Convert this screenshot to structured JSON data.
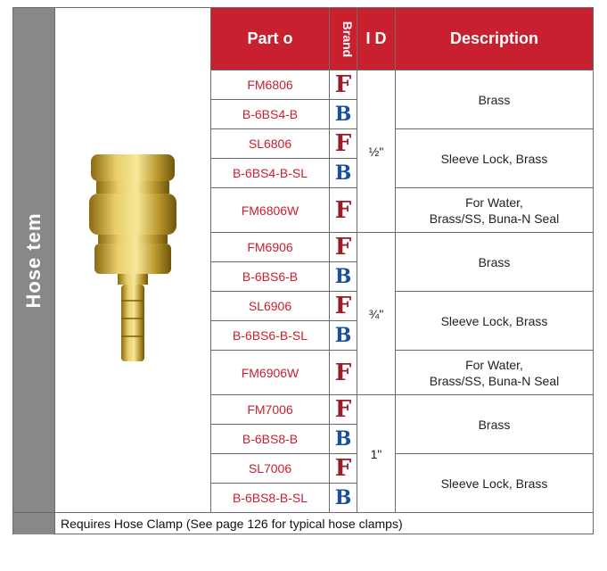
{
  "side_label": "Hose  tem",
  "header": {
    "part_no": "Part  o",
    "brand": "Brand",
    "id": "I D",
    "description": "Description"
  },
  "id_groups": [
    {
      "label": "½\""
    },
    {
      "label": "¾\""
    },
    {
      "label": "1\""
    }
  ],
  "rows": [
    {
      "part": "FM6806",
      "brand": "F"
    },
    {
      "part": "B-6BS4-B",
      "brand": "B"
    },
    {
      "part": "SL6806",
      "brand": "F"
    },
    {
      "part": "B-6BS4-B-SL",
      "brand": "B"
    },
    {
      "part": "FM6806W",
      "brand": "F"
    },
    {
      "part": "FM6906",
      "brand": "F"
    },
    {
      "part": "B-6BS6-B",
      "brand": "B"
    },
    {
      "part": "SL6906",
      "brand": "F"
    },
    {
      "part": "B-6BS6-B-SL",
      "brand": "B"
    },
    {
      "part": "FM6906W",
      "brand": "F"
    },
    {
      "part": "FM7006",
      "brand": "F"
    },
    {
      "part": "B-6BS8-B",
      "brand": "B"
    },
    {
      "part": "SL7006",
      "brand": "F"
    },
    {
      "part": "B-6BS8-B-SL",
      "brand": "B"
    }
  ],
  "descriptions": [
    {
      "line1": "Brass",
      "line2": ""
    },
    {
      "line1": "Sleeve Lock, Brass",
      "line2": ""
    },
    {
      "line1": "For Water,",
      "line2": "Brass/SS, Buna-N Seal"
    },
    {
      "line1": "Brass",
      "line2": ""
    },
    {
      "line1": "Sleeve Lock, Brass",
      "line2": ""
    },
    {
      "line1": "For Water,",
      "line2": "Brass/SS, Buna-N Seal"
    },
    {
      "line1": "Brass",
      "line2": ""
    },
    {
      "line1": "Sleeve Lock, Brass",
      "line2": ""
    }
  ],
  "footer_note": "Requires Hose Clamp (See page 126 for typical hose clamps)",
  "colors": {
    "header_red": "#c8202f",
    "part_red": "#c8202f",
    "brand_F": "#9b1b2b",
    "brand_B": "#1a4fa0",
    "side_gray": "#888888"
  },
  "icons": {
    "product_image": "brass-hose-stem-coupler-icon",
    "brand_F": "brand-f-logo-icon",
    "brand_B": "brand-b-logo-icon"
  }
}
